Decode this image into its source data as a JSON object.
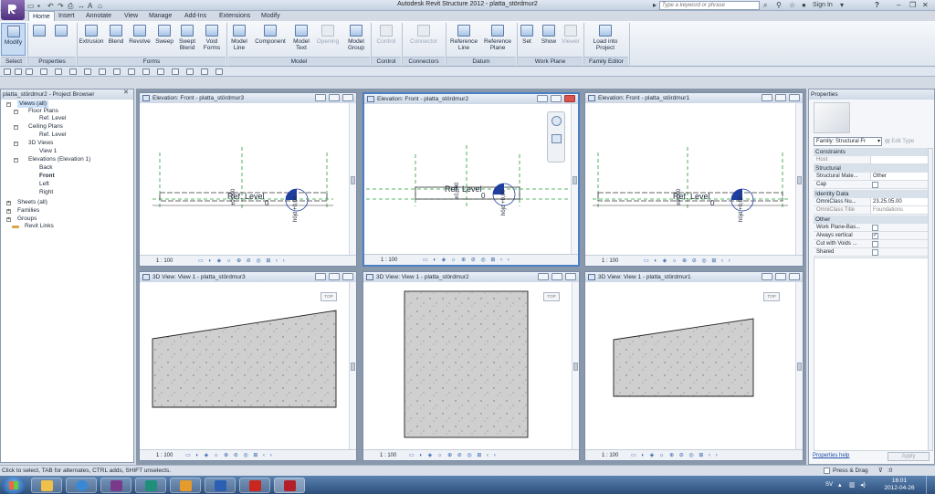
{
  "window": {
    "title": "Autodesk Revit Structure 2012 -   platta_stördmur2",
    "search_placeholder": "Type a keyword or phrase",
    "sign_in": "Sign In",
    "help_icon": "?"
  },
  "ribbon": {
    "tabs": [
      "Home",
      "Insert",
      "Annotate",
      "View",
      "Manage",
      "Add-Ins",
      "Extensions",
      "Modify"
    ],
    "active_tab": "Home",
    "buttons": {
      "modify": "Modify",
      "extrusion": "Extrusion",
      "blend": "Blend",
      "revolve": "Revolve",
      "sweep": "Sweep",
      "swept_blend": "Swept Blend",
      "void_forms": "Void Forms",
      "model_line": "Model Line",
      "component": "Component",
      "model_text": "Model Text",
      "opening": "Opening",
      "model_group": "Model Group",
      "control": "Control",
      "connector": "Connector",
      "reference_line": "Reference Line",
      "reference_plane": "Reference Plane",
      "set": "Set",
      "show": "Show",
      "viewer": "Viewer",
      "load_into_project": "Load into Project"
    },
    "groups": {
      "select": "Select",
      "properties": "Properties",
      "forms": "Forms",
      "model": "Model",
      "control": "Control",
      "connectors": "Connectors",
      "datum": "Datum",
      "work_plane": "Work Plane",
      "family_editor": "Family Editor"
    }
  },
  "project_browser": {
    "title": "platta_stördmur2 - Project Browser",
    "items": {
      "views_all": "Views (all)",
      "floor_plans": "Floor Plans",
      "floor_ref_level": "Ref. Level",
      "ceiling_plans": "Ceiling Plans",
      "ceiling_ref_level": "Ref. Level",
      "views_3d": "3D Views",
      "view_1": "View 1",
      "elevations": "Elevations (Elevation 1)",
      "back": "Back",
      "front": "Front",
      "left": "Left",
      "right": "Right",
      "sheets": "Sheets (all)",
      "families": "Families",
      "groups": "Groups",
      "revit_links": "Revit Links"
    }
  },
  "views": {
    "elev_1_title": "Elevation: Front - platta_stördmur3",
    "elev_2_title": "Elevation: Front - platta_stördmur2",
    "elev_3_title": "Elevation: Front - platta_stördmur1",
    "v3d_1_title": "3D View: View 1 - platta_stördmur3",
    "v3d_2_title": "3D View: View 1 - platta_stördmur2",
    "v3d_3_title": "3D View: View 1 - platta_stördmur1",
    "scale": "1 : 100",
    "ref_level_label": "Ref. Level",
    "level_value": "0",
    "elev_annotation": "±0,000",
    "elev_annotation_b": "höjd +0,00",
    "viewcube_top": "TOP"
  },
  "properties": {
    "title": "Properties",
    "family_selector": "Family: Structural Fr",
    "edit_type": "Edit Type",
    "categories": {
      "constraints": "Constraints",
      "structural": "Structural",
      "identity_data": "Identity Data",
      "other": "Other"
    },
    "rows": {
      "host": "Host",
      "structural_material": "Structural Mate...",
      "structural_material_value": "Other",
      "cap": "Cap",
      "omniclass_number": "OmniClass Nu...",
      "omniclass_number_value": "23.25.05.00",
      "omniclass_title": "OmniClass Title",
      "omniclass_title_value": "Foundations",
      "work_plane_based": "Work Plane-Bas...",
      "always_vertical": "Always vertical",
      "cut_with_voids": "Cut with Voids ...",
      "shared": "Shared"
    },
    "checks": {
      "cap": false,
      "work_plane_based": false,
      "always_vertical": true,
      "cut_with_voids": false,
      "shared": false
    },
    "help_link": "Properties help",
    "apply": "Apply"
  },
  "statusbar": {
    "message": "Click to select, TAB for alternates, CTRL adds, SHIFT unselects.",
    "press_drag": "Press & Drag",
    "filter_count": ":0"
  },
  "taskbar": {
    "language": "SV",
    "time": "16:01",
    "date": "2012-04-26"
  }
}
